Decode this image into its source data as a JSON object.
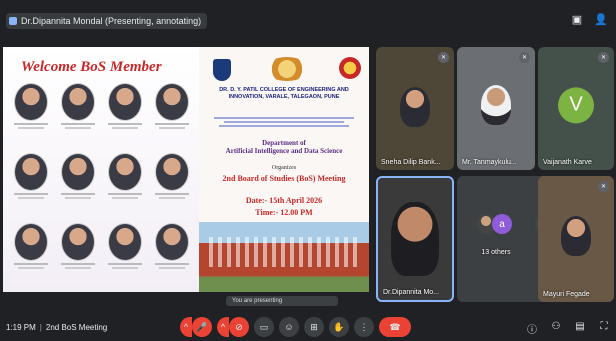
{
  "top": {
    "presenting_chip": "Dr.Dipannita Mondal (Presenting, annotating)"
  },
  "slide": {
    "welcome": "Welcome BoS Member",
    "college_name": "DR. D. Y. PATIL COLLEGE OF ENGINEERING AND INNOVATION, VARALE, TALEGAON, PUNE",
    "department_label": "Department of",
    "department_name": "Artificial Intelligence and Data Science",
    "organizes": "Organizes",
    "meeting_title": "2nd Board of Studies (BoS) Meeting",
    "date": "Date:- 15th April 2026",
    "time": "Time:- 12.00 PM"
  },
  "share_chip": "You are presenting",
  "tiles": [
    {
      "name": "Sneha Dilip Bank..."
    },
    {
      "name": "Mr. Tanmaykulu..."
    },
    {
      "name": "Vaijanath Karve",
      "initial": "V"
    },
    {
      "name": "Dr.Dipannita Mo..."
    },
    {
      "name": "13 others",
      "badge": "a"
    },
    {
      "name": "Mayuri Fegade"
    }
  ],
  "bottom": {
    "time": "1:19 PM",
    "meeting_name": "2nd BoS Meeting"
  },
  "colors": {
    "end_call": "#ea4335",
    "avatar_v": "#7cb342",
    "avatar_a": "#8e5bd9"
  }
}
